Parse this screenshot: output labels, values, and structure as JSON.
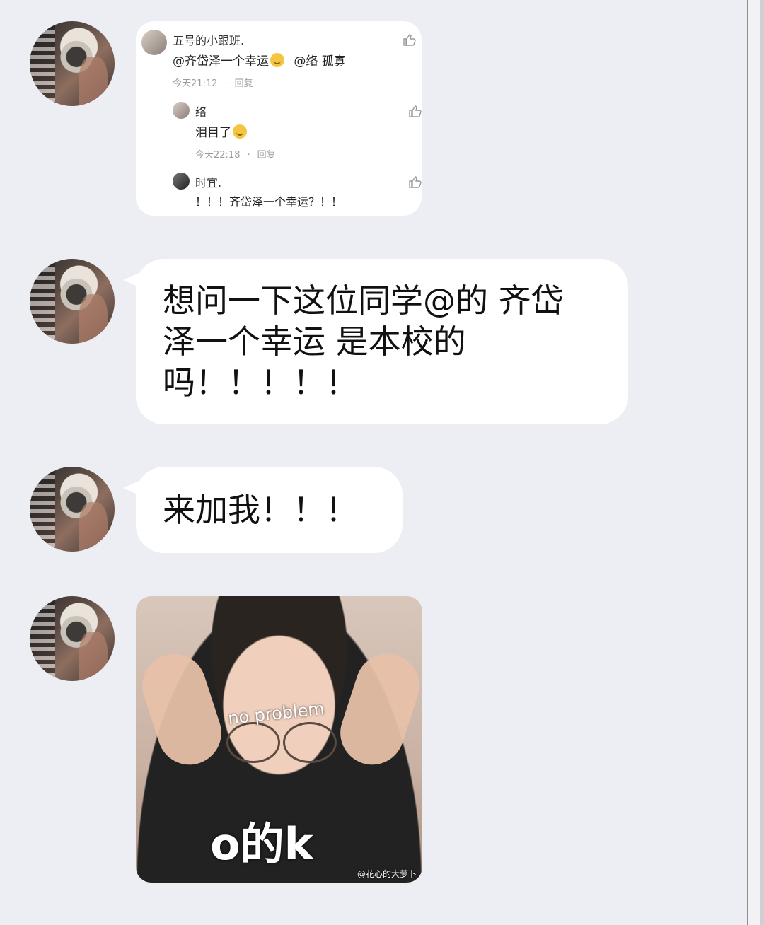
{
  "screen": {
    "background": "#eceef3",
    "bubble_color": "#ffffff"
  },
  "message1": {
    "avatar": "user-avatar",
    "comment_card": {
      "main": {
        "name": "五号的小跟班.",
        "text": "@齐岱泽一个幸运",
        "emoji": "angel-face-emoji",
        "mentions": "@络 孤寡",
        "time": "今天21:12",
        "reply": "回复"
      },
      "reply1": {
        "name": "络",
        "text": "泪目了",
        "emoji": "smile-emoji",
        "time": "今天22:18",
        "reply": "回复"
      },
      "reply2": {
        "name": "时宜.",
        "text": "！！！齐岱泽一个幸运？！！"
      }
    }
  },
  "message2": {
    "lines": [
      "想问一下这位同学@的 齐岱",
      "泽一个幸运 是本校的",
      "吗！！！！！"
    ]
  },
  "message3": {
    "text": "来加我！！！"
  },
  "message4": {
    "sticker": {
      "top_text": "no problem",
      "main_text": "o的k",
      "watermark": "@花心的大萝卜"
    }
  }
}
